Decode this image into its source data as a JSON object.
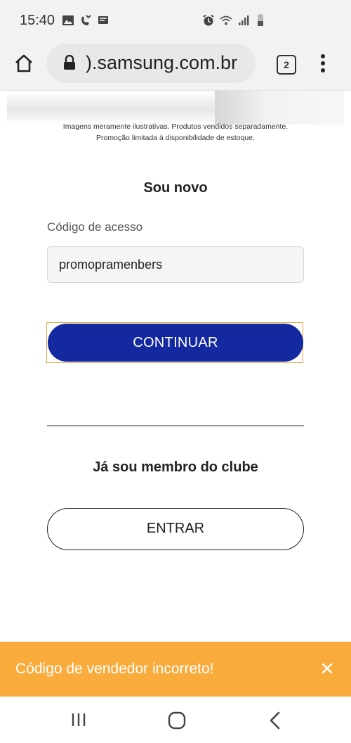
{
  "status_bar": {
    "time": "15:40"
  },
  "browser": {
    "url": ").samsung.com.br",
    "tab_count": "2"
  },
  "banner": {
    "disclaimer_line1": "Imagens meramente ilustrativas. Produtos vendidos separadamente.",
    "disclaimer_line2": "Promoção limitada à disponibilidade de estoque."
  },
  "new_section": {
    "title": "Sou novo",
    "field_label": "Código de acesso",
    "field_value": "promopramenbers",
    "continue_label": "CONTINUAR"
  },
  "member_section": {
    "title": "Já sou membro do clube",
    "enter_label": "ENTRAR"
  },
  "toast": {
    "message": "Código de vendedor incorreto!"
  },
  "colors": {
    "primary_button": "#1428a0",
    "toast_background": "#f9ab3c",
    "focus_outline": "#e3a33a"
  }
}
